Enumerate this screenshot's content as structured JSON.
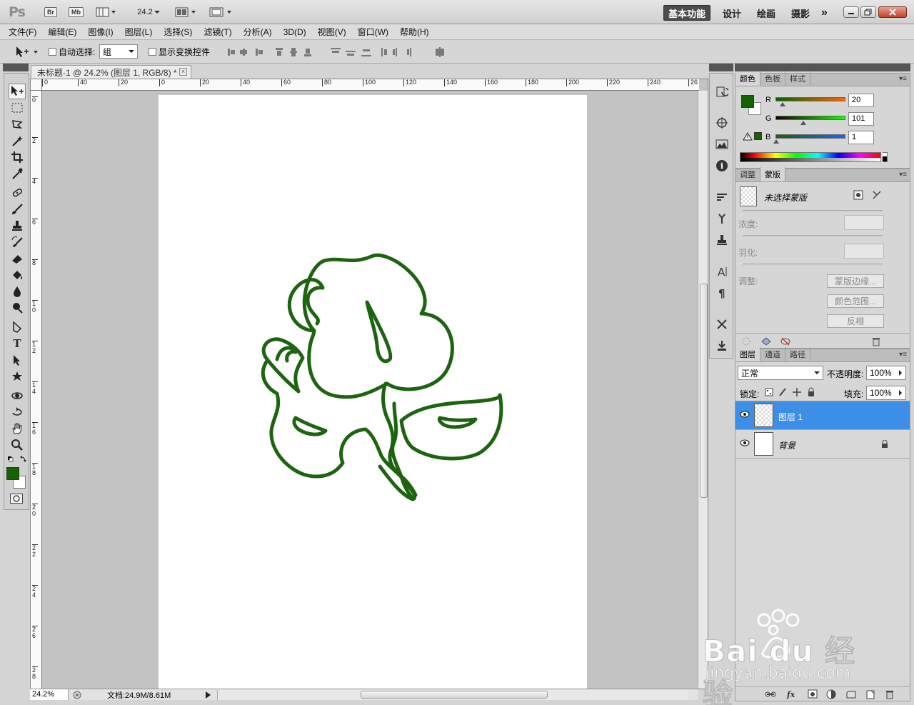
{
  "app": {
    "logo": "Ps",
    "bridge_label": "Br",
    "minibridge_label": "Mb",
    "zoom_dropdown": "24.2",
    "workspaces": [
      "基本功能",
      "设计",
      "绘画",
      "摄影"
    ],
    "more_workspaces": "»"
  },
  "menu": [
    "文件(F)",
    "编辑(E)",
    "图像(I)",
    "图层(L)",
    "选择(S)",
    "滤镜(T)",
    "分析(A)",
    "3D(D)",
    "视图(V)",
    "窗口(W)",
    "帮助(H)"
  ],
  "options": {
    "auto_select_label": "自动选择:",
    "auto_select_value": "组",
    "show_transform_label": "显示变换控件"
  },
  "document": {
    "tab_title": "未标题-1 @ 24.2% (图层 1, RGB/8) *",
    "ruler_h_labels": [
      "0",
      "40",
      "20",
      "0",
      "20",
      "40",
      "60",
      "80",
      "100",
      "120",
      "140",
      "160",
      "180",
      "200",
      "220",
      "240",
      "26"
    ],
    "ruler_v_labels": [
      "0",
      "2",
      "4",
      "6",
      "8",
      "10",
      "12",
      "14",
      "16",
      "18",
      "20",
      "22",
      "24",
      "26",
      "28"
    ],
    "stroke_color": "#1c6410"
  },
  "status": {
    "zoom": "24.2%",
    "doc_info": "文档:24.9M/8.61M"
  },
  "color_panel": {
    "tabs": [
      "颜色",
      "色板",
      "样式"
    ],
    "fg_color": "#146501",
    "r_label": "R",
    "g_label": "G",
    "b_label": "B",
    "r": "20",
    "g": "101",
    "b": "1"
  },
  "mask_panel": {
    "tabs": [
      "调整",
      "蒙版"
    ],
    "title": "未选择蒙版",
    "density_label": "浓度:",
    "feather_label": "羽化:",
    "refine_label": "调整:",
    "mask_edge_button": "蒙版边缘...",
    "color_range_button": "颜色范围...",
    "invert_button": "反相"
  },
  "layers_panel": {
    "tabs": [
      "图层",
      "通道",
      "路径"
    ],
    "blend_mode": "正常",
    "opacity_label": "不透明度:",
    "opacity": "100%",
    "lock_label": "锁定:",
    "fill_label": "填充:",
    "fill": "100%",
    "layers": [
      {
        "name": "图层 1",
        "selected": true
      },
      {
        "name": "背景",
        "selected": false
      }
    ]
  },
  "watermark": {
    "brand": "Bai du 经验",
    "url": "jingyan.baidu.com"
  }
}
